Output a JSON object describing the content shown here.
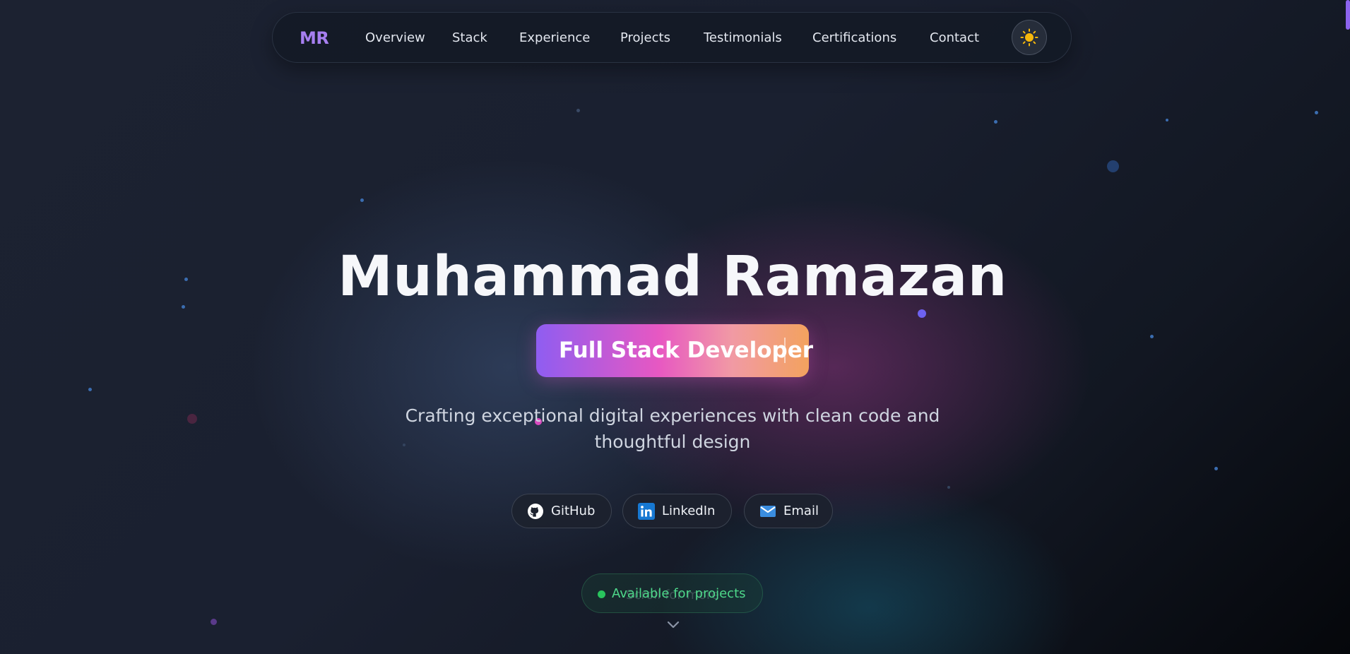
{
  "nav": {
    "logo": "MR",
    "links": [
      "Overview",
      "Stack",
      "Experience",
      "Projects",
      "Testimonials",
      "Certifications",
      "Contact"
    ],
    "theme_toggle_icon": "sun-icon"
  },
  "hero": {
    "name": "Muhammad Ramazan",
    "role": "Full Stack Developer",
    "tagline": "Crafting exceptional digital experiences with clean code and thoughtful design"
  },
  "social": [
    {
      "label": "GitHub",
      "icon": "github-icon"
    },
    {
      "label": "LinkedIn",
      "icon": "linkedin-icon"
    },
    {
      "label": "Email",
      "icon": "mail-icon"
    }
  ],
  "status": {
    "label": "Available for projects"
  },
  "scroll": {
    "hint": "Scroll for more",
    "icon": "chevron-down-icon"
  },
  "colors": {
    "accent_purple": "#a77ff0",
    "role_gradient": [
      "#8f5df1",
      "#e758c2",
      "#f3a25e"
    ],
    "status_green": "#29c45d"
  }
}
